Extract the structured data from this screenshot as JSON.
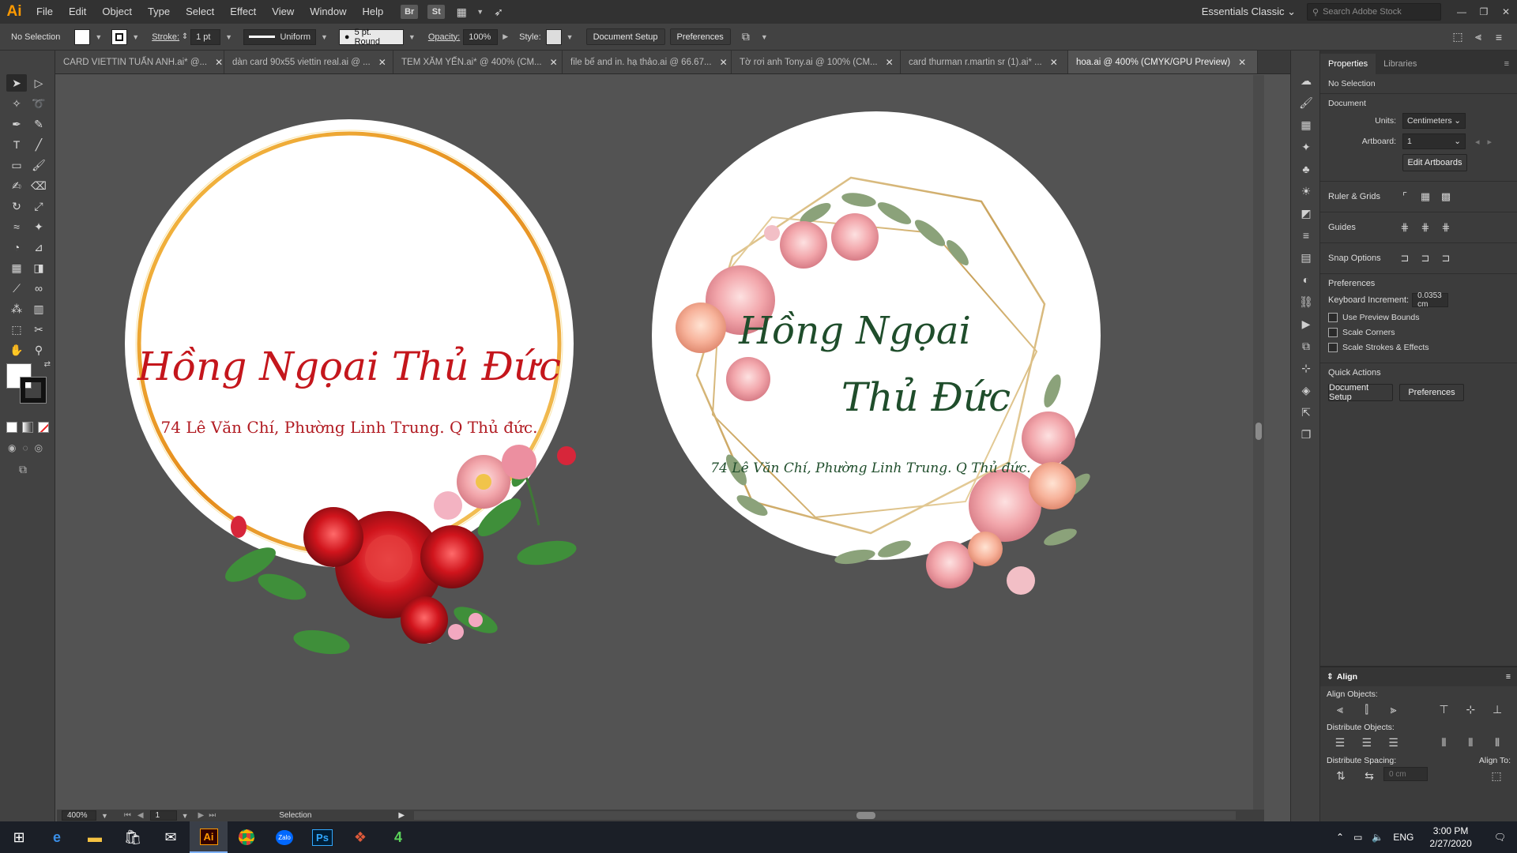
{
  "app": {
    "logo": "Ai",
    "menu": [
      "File",
      "Edit",
      "Object",
      "Type",
      "Select",
      "Effect",
      "View",
      "Window",
      "Help"
    ],
    "bridge_buttons": [
      "Br",
      "St"
    ],
    "workspace": "Essentials Classic",
    "search_placeholder": "Search Adobe Stock"
  },
  "control_bar": {
    "selection": "No Selection",
    "stroke_label": "Stroke:",
    "stroke_value": "1 pt",
    "profile": "Uniform",
    "brush": "5 pt. Round",
    "opacity_label": "Opacity:",
    "opacity_value": "100%",
    "style_label": "Style:",
    "doc_setup": "Document Setup",
    "preferences": "Preferences"
  },
  "tabs": [
    {
      "label": "CARD VIETTIN TUẤN ANH.ai* @...",
      "active": false
    },
    {
      "label": "dàn card 90x55 viettin real.ai @ ...",
      "active": false
    },
    {
      "label": "TEM XĂM YẾN.ai* @ 400% (CM...",
      "active": false
    },
    {
      "label": "file bế and in. hạ thảo.ai @ 66.67...",
      "active": false
    },
    {
      "label": "Tờ rơi anh Tony.ai @ 100% (CM...",
      "active": false
    },
    {
      "label": "card thurman r.martin sr (1).ai* ...",
      "active": false
    },
    {
      "label": "hoa.ai @ 400% (CMYK/GPU Preview)",
      "active": true
    }
  ],
  "artwork": {
    "left": {
      "title": "Hồng Ngọai Thủ Đức",
      "address": "74 Lê Văn Chí, Phường Linh Trung. Q Thủ đức."
    },
    "right": {
      "title_line1": "Hồng Ngọai",
      "title_line2": "Thủ Đức",
      "address": "74 Lê Văn Chí, Phường Linh Trung. Q Thủ đức."
    }
  },
  "properties": {
    "tabs": [
      "Properties",
      "Libraries"
    ],
    "selection": "No Selection",
    "document_header": "Document",
    "units_label": "Units:",
    "units_value": "Centimeters",
    "artboard_label": "Artboard:",
    "artboard_value": "1",
    "edit_artboards": "Edit Artboards",
    "ruler_grids": "Ruler & Grids",
    "guides": "Guides",
    "snap_options": "Snap Options",
    "preferences_header": "Preferences",
    "keyboard_increment_label": "Keyboard Increment:",
    "keyboard_increment_value": "0.0353 cm",
    "checkboxes": [
      "Use Preview Bounds",
      "Scale Corners",
      "Scale Strokes & Effects"
    ],
    "quick_actions": "Quick Actions",
    "qa_doc_setup": "Document Setup",
    "qa_preferences": "Preferences"
  },
  "align": {
    "title": "Align",
    "align_objects": "Align Objects:",
    "distribute_objects": "Distribute Objects:",
    "distribute_spacing": "Distribute Spacing:",
    "align_to": "Align To:",
    "spacing_value": "0 cm"
  },
  "status": {
    "zoom": "400%",
    "artboard": "1",
    "tool": "Selection"
  },
  "taskbar": {
    "apps": [
      "start-icon",
      "edge-icon",
      "explorer-icon",
      "store-icon",
      "mail-icon",
      "illustrator-icon",
      "chrome-icon",
      "zalo-icon",
      "photoshop-icon",
      "app-icon",
      "app4-icon"
    ],
    "ai_label": "Ai",
    "ps_label": "Ps",
    "zalo_label": "Zalo",
    "lang": "ENG",
    "time": "3:00 PM",
    "date": "2/27/2020"
  },
  "colors": {
    "accent_red": "#c4161c",
    "accent_green": "#1f4d2b",
    "gold": "#e7a52a"
  }
}
